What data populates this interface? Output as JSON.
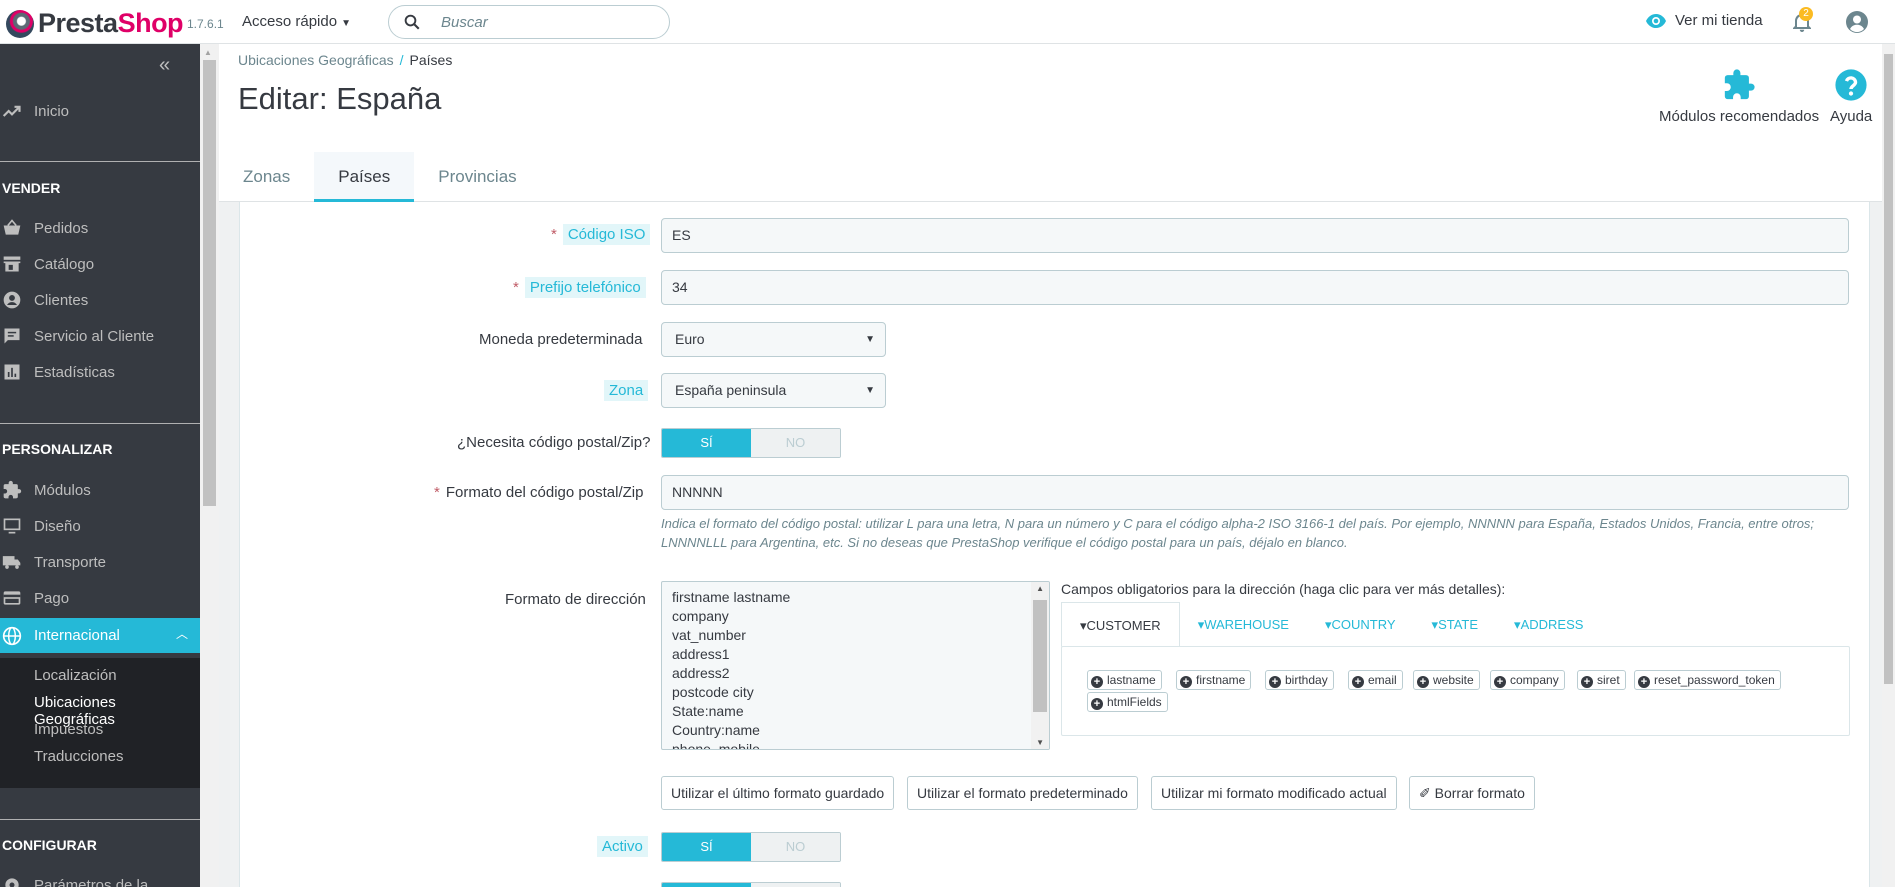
{
  "header": {
    "logo_prefix": "Presta",
    "logo_suffix": "Shop",
    "version": "1.7.6.1",
    "quick_access": "Acceso rápido",
    "search_placeholder": "Buscar",
    "view_store": "Ver mi tienda",
    "notifications_count": "2",
    "accent_color": "#25b9d7"
  },
  "sidebar": {
    "collapse": "«",
    "home": "Inicio",
    "sections": [
      {
        "title": "VENDER",
        "items": [
          "Pedidos",
          "Catálogo",
          "Clientes",
          "Servicio al Cliente",
          "Estadísticas"
        ]
      },
      {
        "title": "PERSONALIZAR",
        "items": [
          "Módulos",
          "Diseño",
          "Transporte",
          "Pago",
          "Internacional"
        ]
      },
      {
        "title": "CONFIGURAR",
        "items": [
          "Parámetros de la"
        ]
      }
    ],
    "submenu": [
      "Localización",
      "Ubicaciones Geográficas",
      "Impuestos",
      "Traducciones"
    ]
  },
  "pagehead": {
    "breadcrumb_parent": "Ubicaciones Geográficas",
    "breadcrumb_current": "Países",
    "title": "Editar: España",
    "toolbar": {
      "modules": "Módulos recomendados",
      "help": "Ayuda"
    },
    "tabs": [
      "Zonas",
      "Países",
      "Provincias"
    ],
    "active_tab": "Países"
  },
  "form": {
    "iso_label": "Código ISO",
    "iso_value": "ES",
    "phone_label": "Prefijo telefónico",
    "phone_value": "34",
    "currency_label": "Moneda predeterminada",
    "currency_value": "Euro",
    "zone_label": "Zona",
    "zone_value": "España peninsula",
    "zip_needed_label": "¿Necesita código postal/Zip?",
    "yes": "SÍ",
    "no": "NO",
    "zip_format_label": "Formato del código postal/Zip",
    "zip_format_value": "NNNNN",
    "zip_help": "Indica el formato del código postal: utilizar L para una letra, N para un número y C para el código alpha-2 ISO 3166-1 del país. Por ejemplo, NNNNN para España, Estados Unidos, Francia, entre otros; LNNNNLLL para Argentina, etc. Si no deseas que PrestaShop verifique el código postal para un país, déjalo en blanco.",
    "address_format_label": "Formato de dirección",
    "address_lines": [
      "firstname lastname",
      "company",
      "vat_number",
      "address1",
      "address2",
      "postcode city",
      "State:name",
      "Country:name",
      "phone_mobile"
    ],
    "required_fields_title": "Campos obligatorios para la dirección (haga clic para ver más detalles):",
    "required_tabs": [
      "CUSTOMER",
      "WAREHOUSE",
      "COUNTRY",
      "STATE",
      "ADDRESS"
    ],
    "customer_fields": [
      "lastname",
      "firstname",
      "birthday",
      "email",
      "website",
      "company",
      "siret",
      "reset_password_token",
      "htmlFields"
    ],
    "format_buttons": [
      "Utilizar el último formato guardado",
      "Utilizar el formato predeterminado",
      "Utilizar mi formato modificado actual",
      "Borrar formato"
    ],
    "active_label": "Activo"
  }
}
